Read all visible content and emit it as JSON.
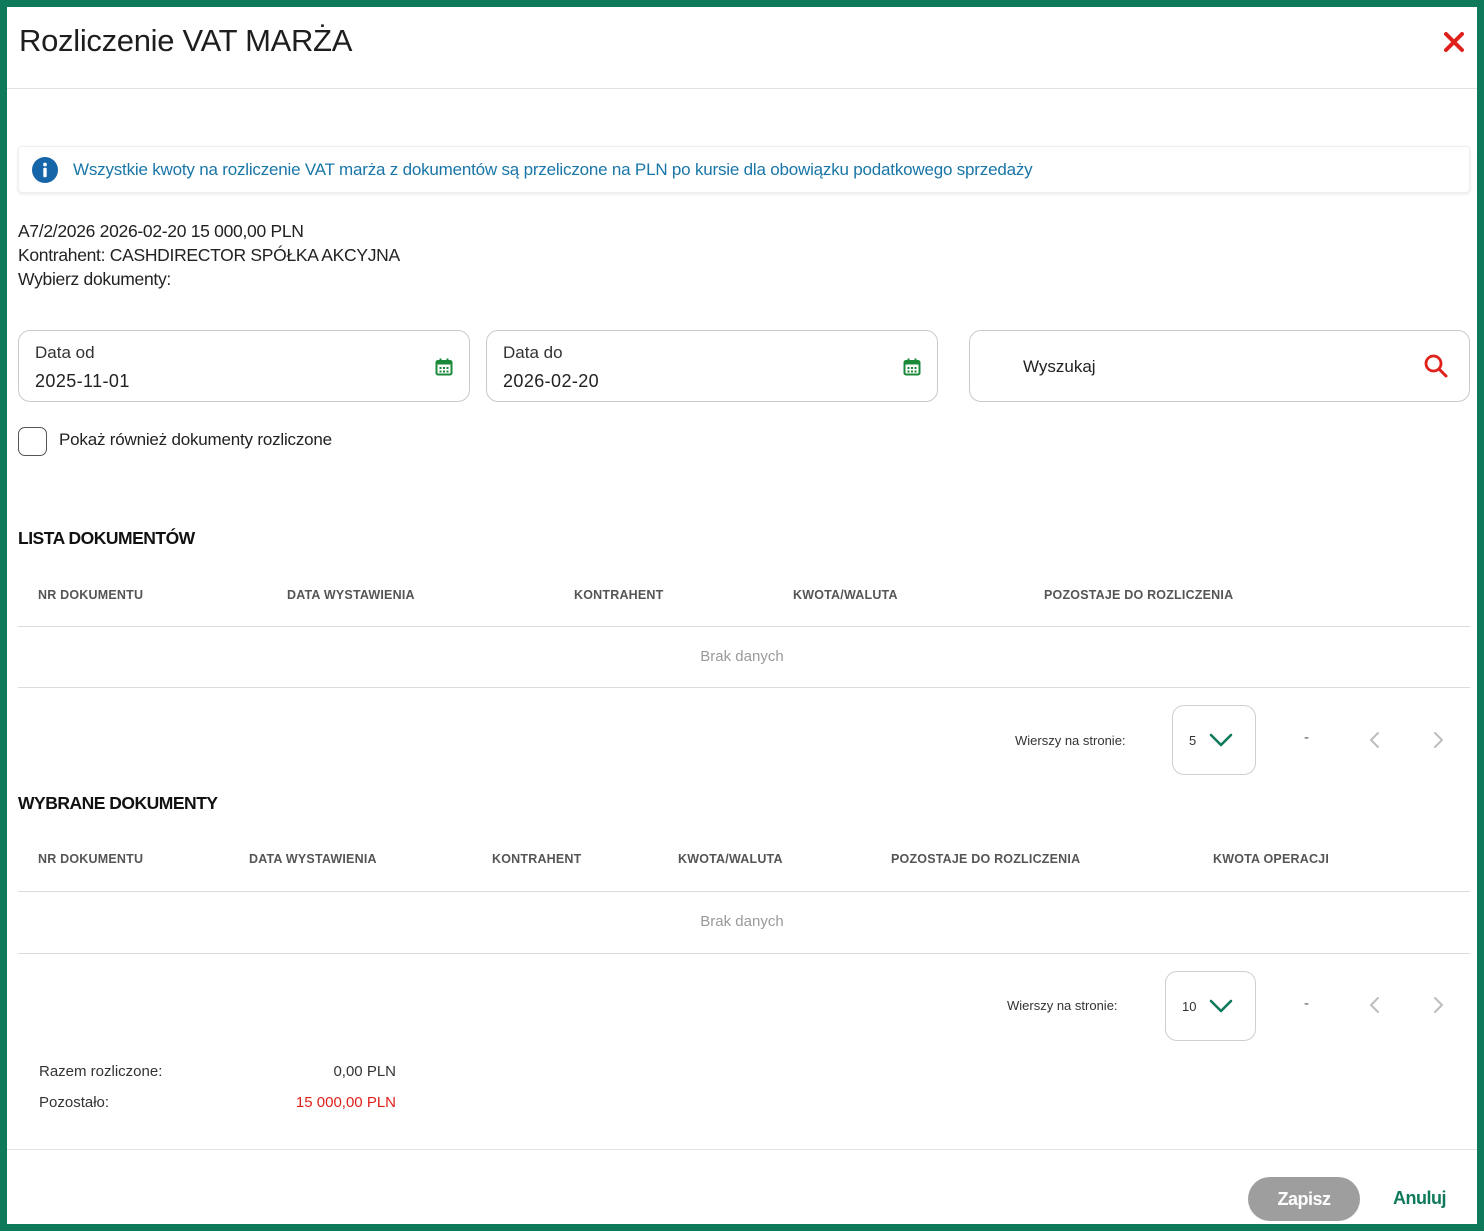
{
  "dialog": {
    "title": "Rozliczenie VAT MARŻA"
  },
  "info": {
    "text": "Wszystkie kwoty na rozliczenie VAT marża z dokumentów są przeliczone na PLN po kursie dla obowiązku podatkowego sprzedaży"
  },
  "document": {
    "line1": "A7/2/2026 2026-02-20 15 000,00 PLN",
    "line2": "Kontrahent: CASHDIRECTOR SPÓŁKA AKCYJNA",
    "line3": "Wybierz dokumenty:"
  },
  "filters": {
    "date_from_label": "Data od",
    "date_from_value": "2025-11-01",
    "date_to_label": "Data do",
    "date_to_value": "2026-02-20",
    "search_label": "Wyszukaj",
    "show_settled_label": "Pokaż również dokumenty rozliczone",
    "show_settled_checked": false
  },
  "documents_list": {
    "title": "LISTA DOKUMENTÓW",
    "columns": [
      "NR DOKUMENTU",
      "DATA WYSTAWIENIA",
      "KONTRAHENT",
      "KWOTA/WALUTA",
      "POZOSTAJE DO ROZLICZENIA"
    ],
    "empty_text": "Brak danych",
    "rows_per_page_label": "Wierszy na stronie:",
    "rows_per_page": "5",
    "range_text": "-"
  },
  "selected_documents": {
    "title": "WYBRANE DOKUMENTY",
    "columns": [
      "NR DOKUMENTU",
      "DATA WYSTAWIENIA",
      "KONTRAHENT",
      "KWOTA/WALUTA",
      "POZOSTAJE DO ROZLICZENIA",
      "KWOTA OPERACJI"
    ],
    "empty_text": "Brak danych",
    "rows_per_page_label": "Wierszy na stronie:",
    "rows_per_page": "10",
    "range_text": "-"
  },
  "summary": {
    "settled_label": "Razem rozliczone:",
    "settled_value": "0,00 PLN",
    "remaining_label": "Pozostało:",
    "remaining_value": "15 000,00 PLN"
  },
  "footer": {
    "save_label": "Zapisz",
    "cancel_label": "Anuluj"
  },
  "colors": {
    "brand_green": "#0f7a5b",
    "close_red": "#e0201b",
    "info_blue": "#1976a8",
    "remaining_red": "#e0201b",
    "calendar_green": "#1a8a3a",
    "save_disabled_gray": "#9e9e9e"
  },
  "icons": {
    "close": "close-icon",
    "info": "info-icon",
    "calendar": "calendar-icon",
    "search": "search-icon",
    "chevron_down": "chevron-down-icon",
    "chevron_left": "chevron-left-icon",
    "chevron_right": "chevron-right-icon"
  }
}
